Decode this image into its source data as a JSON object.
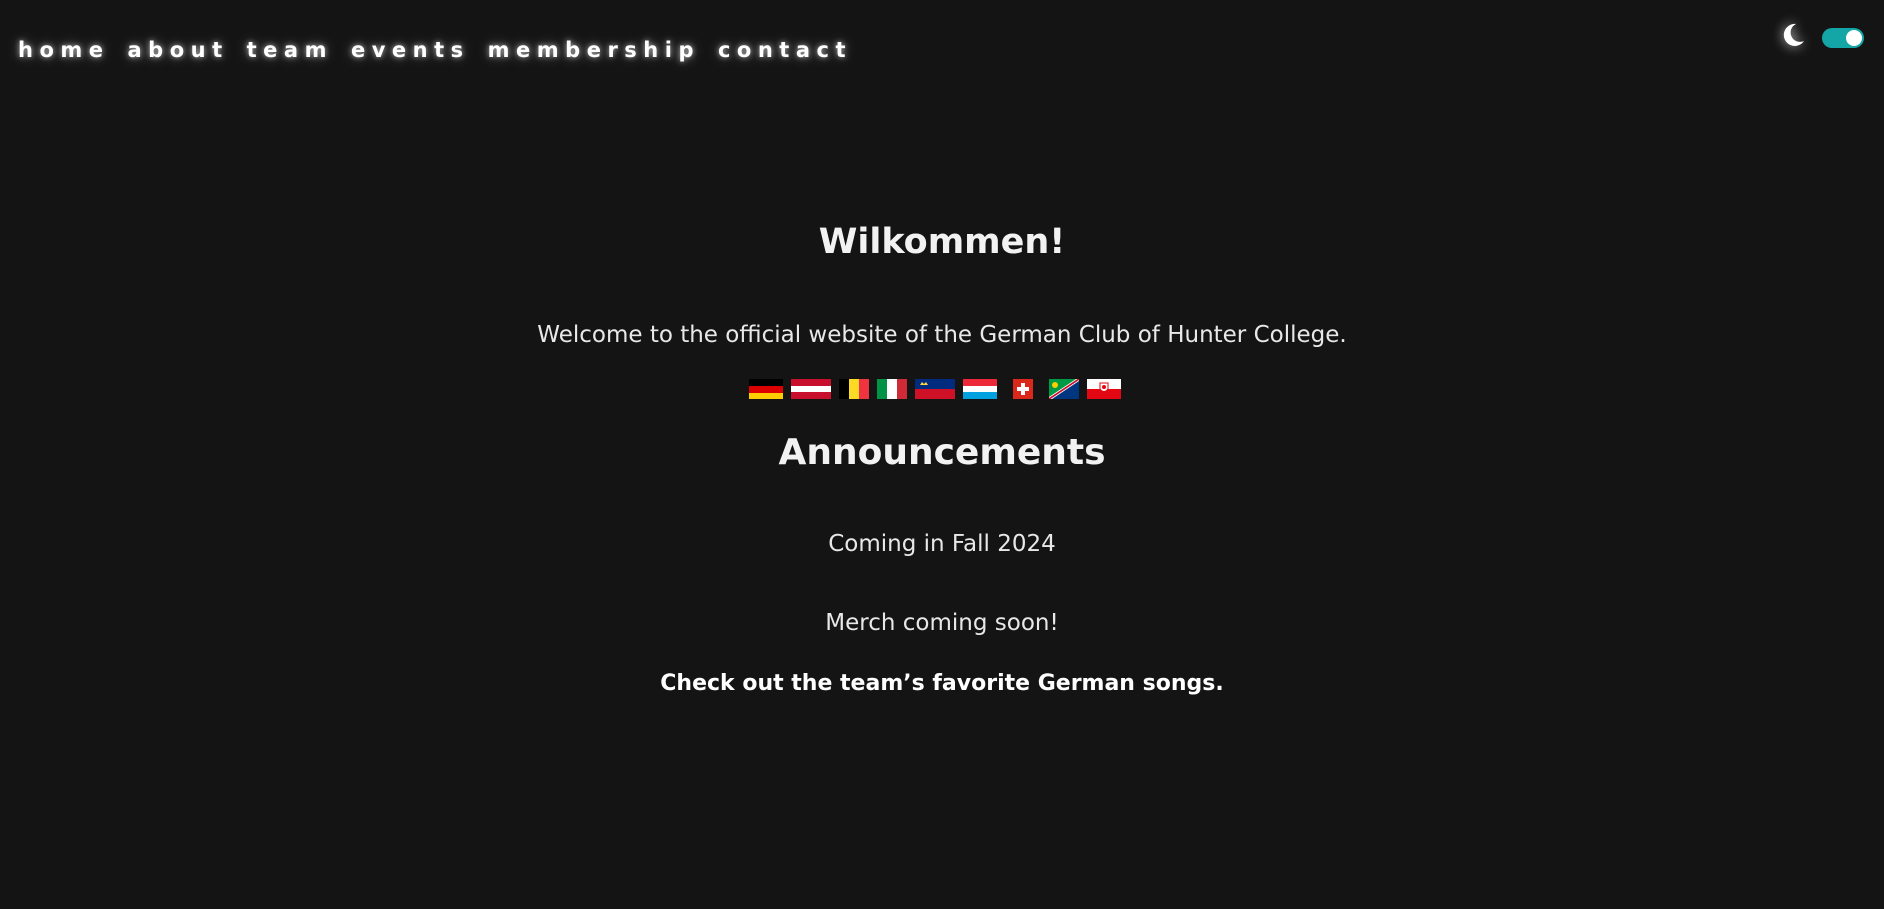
{
  "nav": {
    "items": [
      "home",
      "about",
      "team",
      "events",
      "membership",
      "contact"
    ]
  },
  "theme_toggle": {
    "icon": "moon-icon",
    "state": "on",
    "accent": "#14a6a6"
  },
  "main": {
    "title": "Wilkommen!",
    "welcome": "Welcome to the official website of the German Club of Hunter College.",
    "flags": [
      "germany-flag",
      "austria-flag",
      "belgium-flag",
      "italy-flag",
      "liechtenstein-flag",
      "luxembourg-flag",
      "switzerland-flag",
      "namibia-flag",
      "south-tyrol-flag"
    ],
    "announcements_heading": "Announcements",
    "coming": "Coming in Fall 2024",
    "merch": "Merch coming soon!",
    "songs_link": "Check out the team’s favorite German songs."
  },
  "colors": {
    "background": "#141414",
    "text": "#f2f2f2"
  }
}
